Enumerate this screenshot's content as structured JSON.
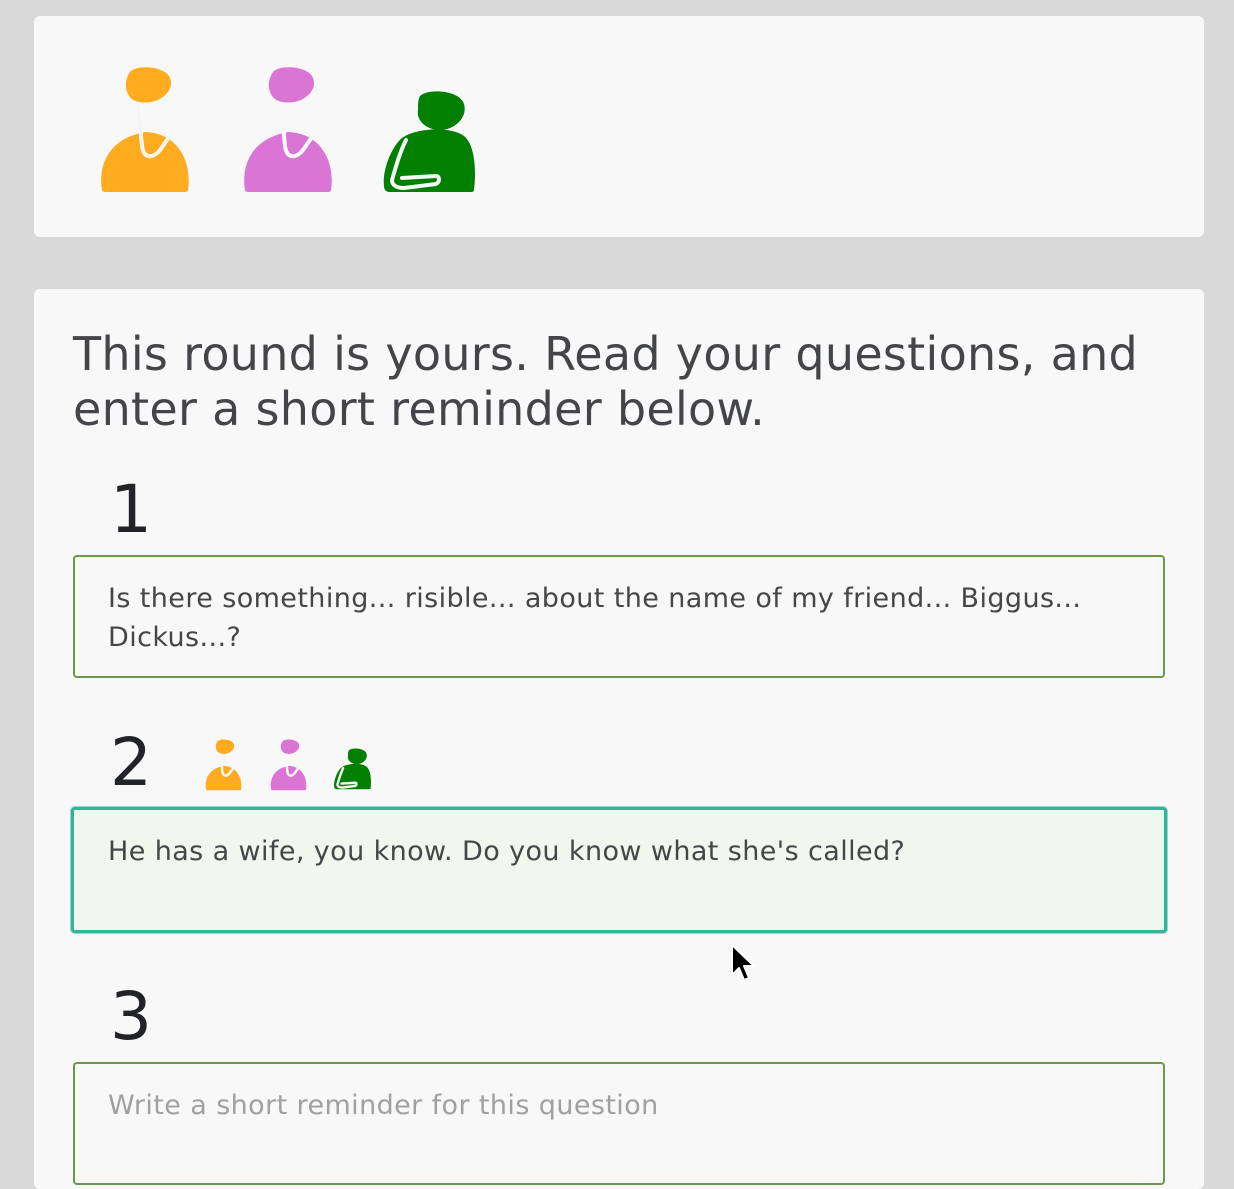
{
  "players": [
    {
      "id": "orange",
      "color": "#ffab20",
      "pose": "thinking"
    },
    {
      "id": "pink",
      "color": "#da75d6",
      "pose": "thinking"
    },
    {
      "id": "green",
      "color": "#007f00",
      "pose": "leaning"
    }
  ],
  "round": {
    "heading": "This round is yours. Read your questions, and enter a short reminder below.",
    "questions": [
      {
        "number": "1",
        "text": "Is there something... risible... about the name of my friend... Biggus... Dickus...?",
        "placeholder": "Write a short reminder for this question"
      },
      {
        "number": "2",
        "text": "He has a wife, you know. Do you know what she's called?",
        "placeholder": "Write a short reminder for this question",
        "answered_by": [
          "orange",
          "pink",
          "green"
        ]
      },
      {
        "number": "3",
        "text": "",
        "placeholder": "Write a short reminder for this question"
      }
    ]
  },
  "colors": {
    "accent_border": "#6a9a48",
    "focus_border": "#35b39a",
    "focus_fill": "#f0f7ee"
  }
}
